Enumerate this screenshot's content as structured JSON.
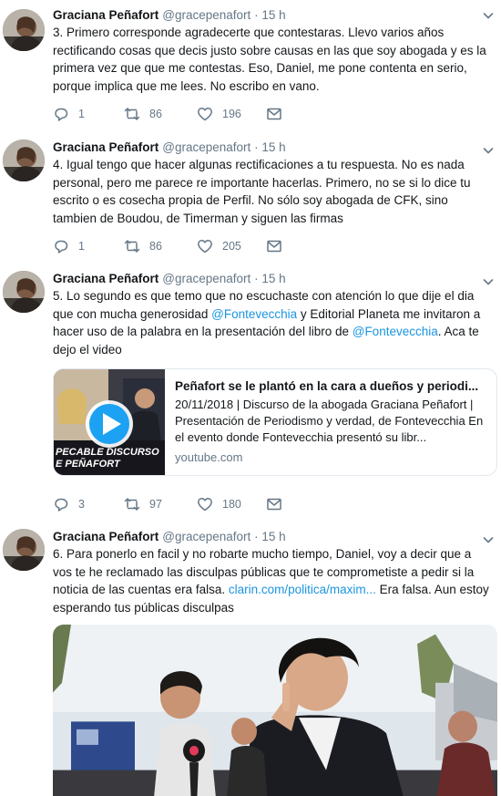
{
  "tweets": [
    {
      "name": "Graciana Peñafort",
      "handle": "@gracepenafort",
      "sep": "·",
      "time": "15 h",
      "text": "3. Primero corresponde agradecerte que contestaras. Llevo varios años rectificando cosas que decis justo sobre causas en las que soy abogada y es la primera vez que que me contestas. Eso, Daniel, me pone contenta en serio, porque implica que me lees. No escribo en vano.",
      "replies": "1",
      "retweets": "86",
      "likes": "196"
    },
    {
      "name": "Graciana Peñafort",
      "handle": "@gracepenafort",
      "sep": "·",
      "time": "15 h",
      "text": "4. Igual tengo que hacer algunas rectificaciones a tu respuesta. No es nada personal, pero me parece re importante hacerlas. Primero, no se si lo dice tu escrito o es cosecha propia de Perfil. No sólo soy abogada de CFK, sino tambien de Boudou, de Timerman y siguen las firmas",
      "replies": "1",
      "retweets": "86",
      "likes": "205"
    },
    {
      "name": "Graciana Peñafort",
      "handle": "@gracepenafort",
      "sep": "·",
      "time": "15 h",
      "text_a": "5. Lo segundo es que temo que no escuchaste con atención lo que dije el dia que con mucha generosidad ",
      "mention1": "@Fontevecchia",
      "text_b": " y Editorial Planeta me invitaron a hacer uso de la palabra en la presentación del libro de ",
      "mention2": "@Fontevecchia",
      "text_c": ". Aca te dejo el video",
      "card": {
        "title": "Peñafort se le plantó en la cara a dueños y periodi...",
        "description": "20/11/2018 | Discurso de la abogada Graciana Peñafort | Presentación de Periodismo y verdad, de Fontevecchia En el evento donde Fontevecchia presentó su libr...",
        "domain": "youtube.com",
        "thumb_caption_1": "PECABLE DISCURSO",
        "thumb_caption_2": "E PEÑAFORT"
      },
      "replies": "3",
      "retweets": "97",
      "likes": "180"
    },
    {
      "name": "Graciana Peñafort",
      "handle": "@gracepenafort",
      "sep": "·",
      "time": "15 h",
      "text_a": "6. Para ponerlo en facil y no robarte mucho tiempo, Daniel, voy a decir que a vos te he reclamado las disculpas públicas que te comprometiste a pedir si la noticia de las cuentas era falsa. ",
      "link": "clarin.com/politica/maxim...",
      "text_b": " Era falsa.  Aun  estoy esperando tus públicas disculpas"
    }
  ],
  "icons": {
    "reply": "reply-icon",
    "retweet": "retweet-icon",
    "like": "heart-icon",
    "dm": "envelope-icon",
    "more": "chevron-down-icon",
    "play": "play-icon"
  },
  "colors": {
    "text": "#14171a",
    "secondary": "#657786",
    "link": "#1b95e0",
    "border": "#e1e8ed"
  }
}
